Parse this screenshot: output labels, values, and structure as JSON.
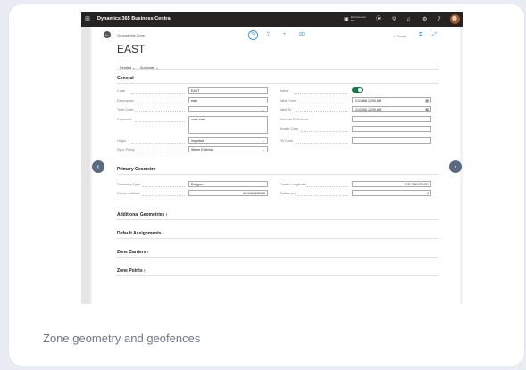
{
  "caption": "Zone geometry and geofences",
  "app": {
    "name": "Dynamics 365 Business Central",
    "environment_line1": "Environment",
    "environment_line2": "Bis"
  },
  "header": {
    "breadcrumb": "Geographic Zone",
    "title": "EAST",
    "saved": "✓ Saved"
  },
  "menu": {
    "related": "Related ⌄",
    "automate": "Automate ⌄"
  },
  "general": {
    "heading": "General",
    "code_label": "Code",
    "code_value": "EAST",
    "description_label": "Description",
    "description_value": "east",
    "type_code_label": "Type Code",
    "type_code_value": "",
    "comment_label": "Comment",
    "comment_value": "main east",
    "origin_label": "Origin",
    "origin_value": "Imported",
    "sync_policy_label": "Sync Policy",
    "sync_policy_value": "Wimer External",
    "active_label": "Active",
    "active_value": true,
    "valid_from_label": "Valid From",
    "valid_from_value": "1/1/1888 12:00 AM",
    "valid_to_label": "Valid To",
    "valid_to_value": "1/1/2050 12:00 AM",
    "external_ref_label": "External Reference",
    "external_ref_value": "",
    "border_color_label": "Border Color",
    "border_color_value": "",
    "fill_color_label": "Fill Color",
    "fill_color_value": ""
  },
  "primary": {
    "heading": "Primary Geometry",
    "geometry_type_label": "Geometry Type",
    "geometry_type_value": "Polygon",
    "center_lat_label": "Center Latitude",
    "center_lat_value": "38.1184445128",
    "center_lon_label": "Center Longitude",
    "center_lon_value": "-119.1284476431",
    "radius_label": "Radius (m)",
    "radius_value": "0"
  },
  "sections": {
    "additional": "Additional Geometries ›",
    "default_assignments": "Default Assignments ›",
    "zone_carriers": "Zone Carriers ›",
    "zone_points": "Zone Points ›"
  },
  "icons": {
    "waffle": "⊞",
    "settings": "⚙",
    "search": "⚲",
    "bell": "🔔",
    "help": "?",
    "back": "←",
    "edit": "✎",
    "share": "⇪",
    "add": "+",
    "delete": "🗑",
    "prev": "‹",
    "next": "›"
  },
  "colors": {
    "accent": "#3a96dd",
    "toggle_on": "#107c41",
    "topbar": "#252423"
  }
}
